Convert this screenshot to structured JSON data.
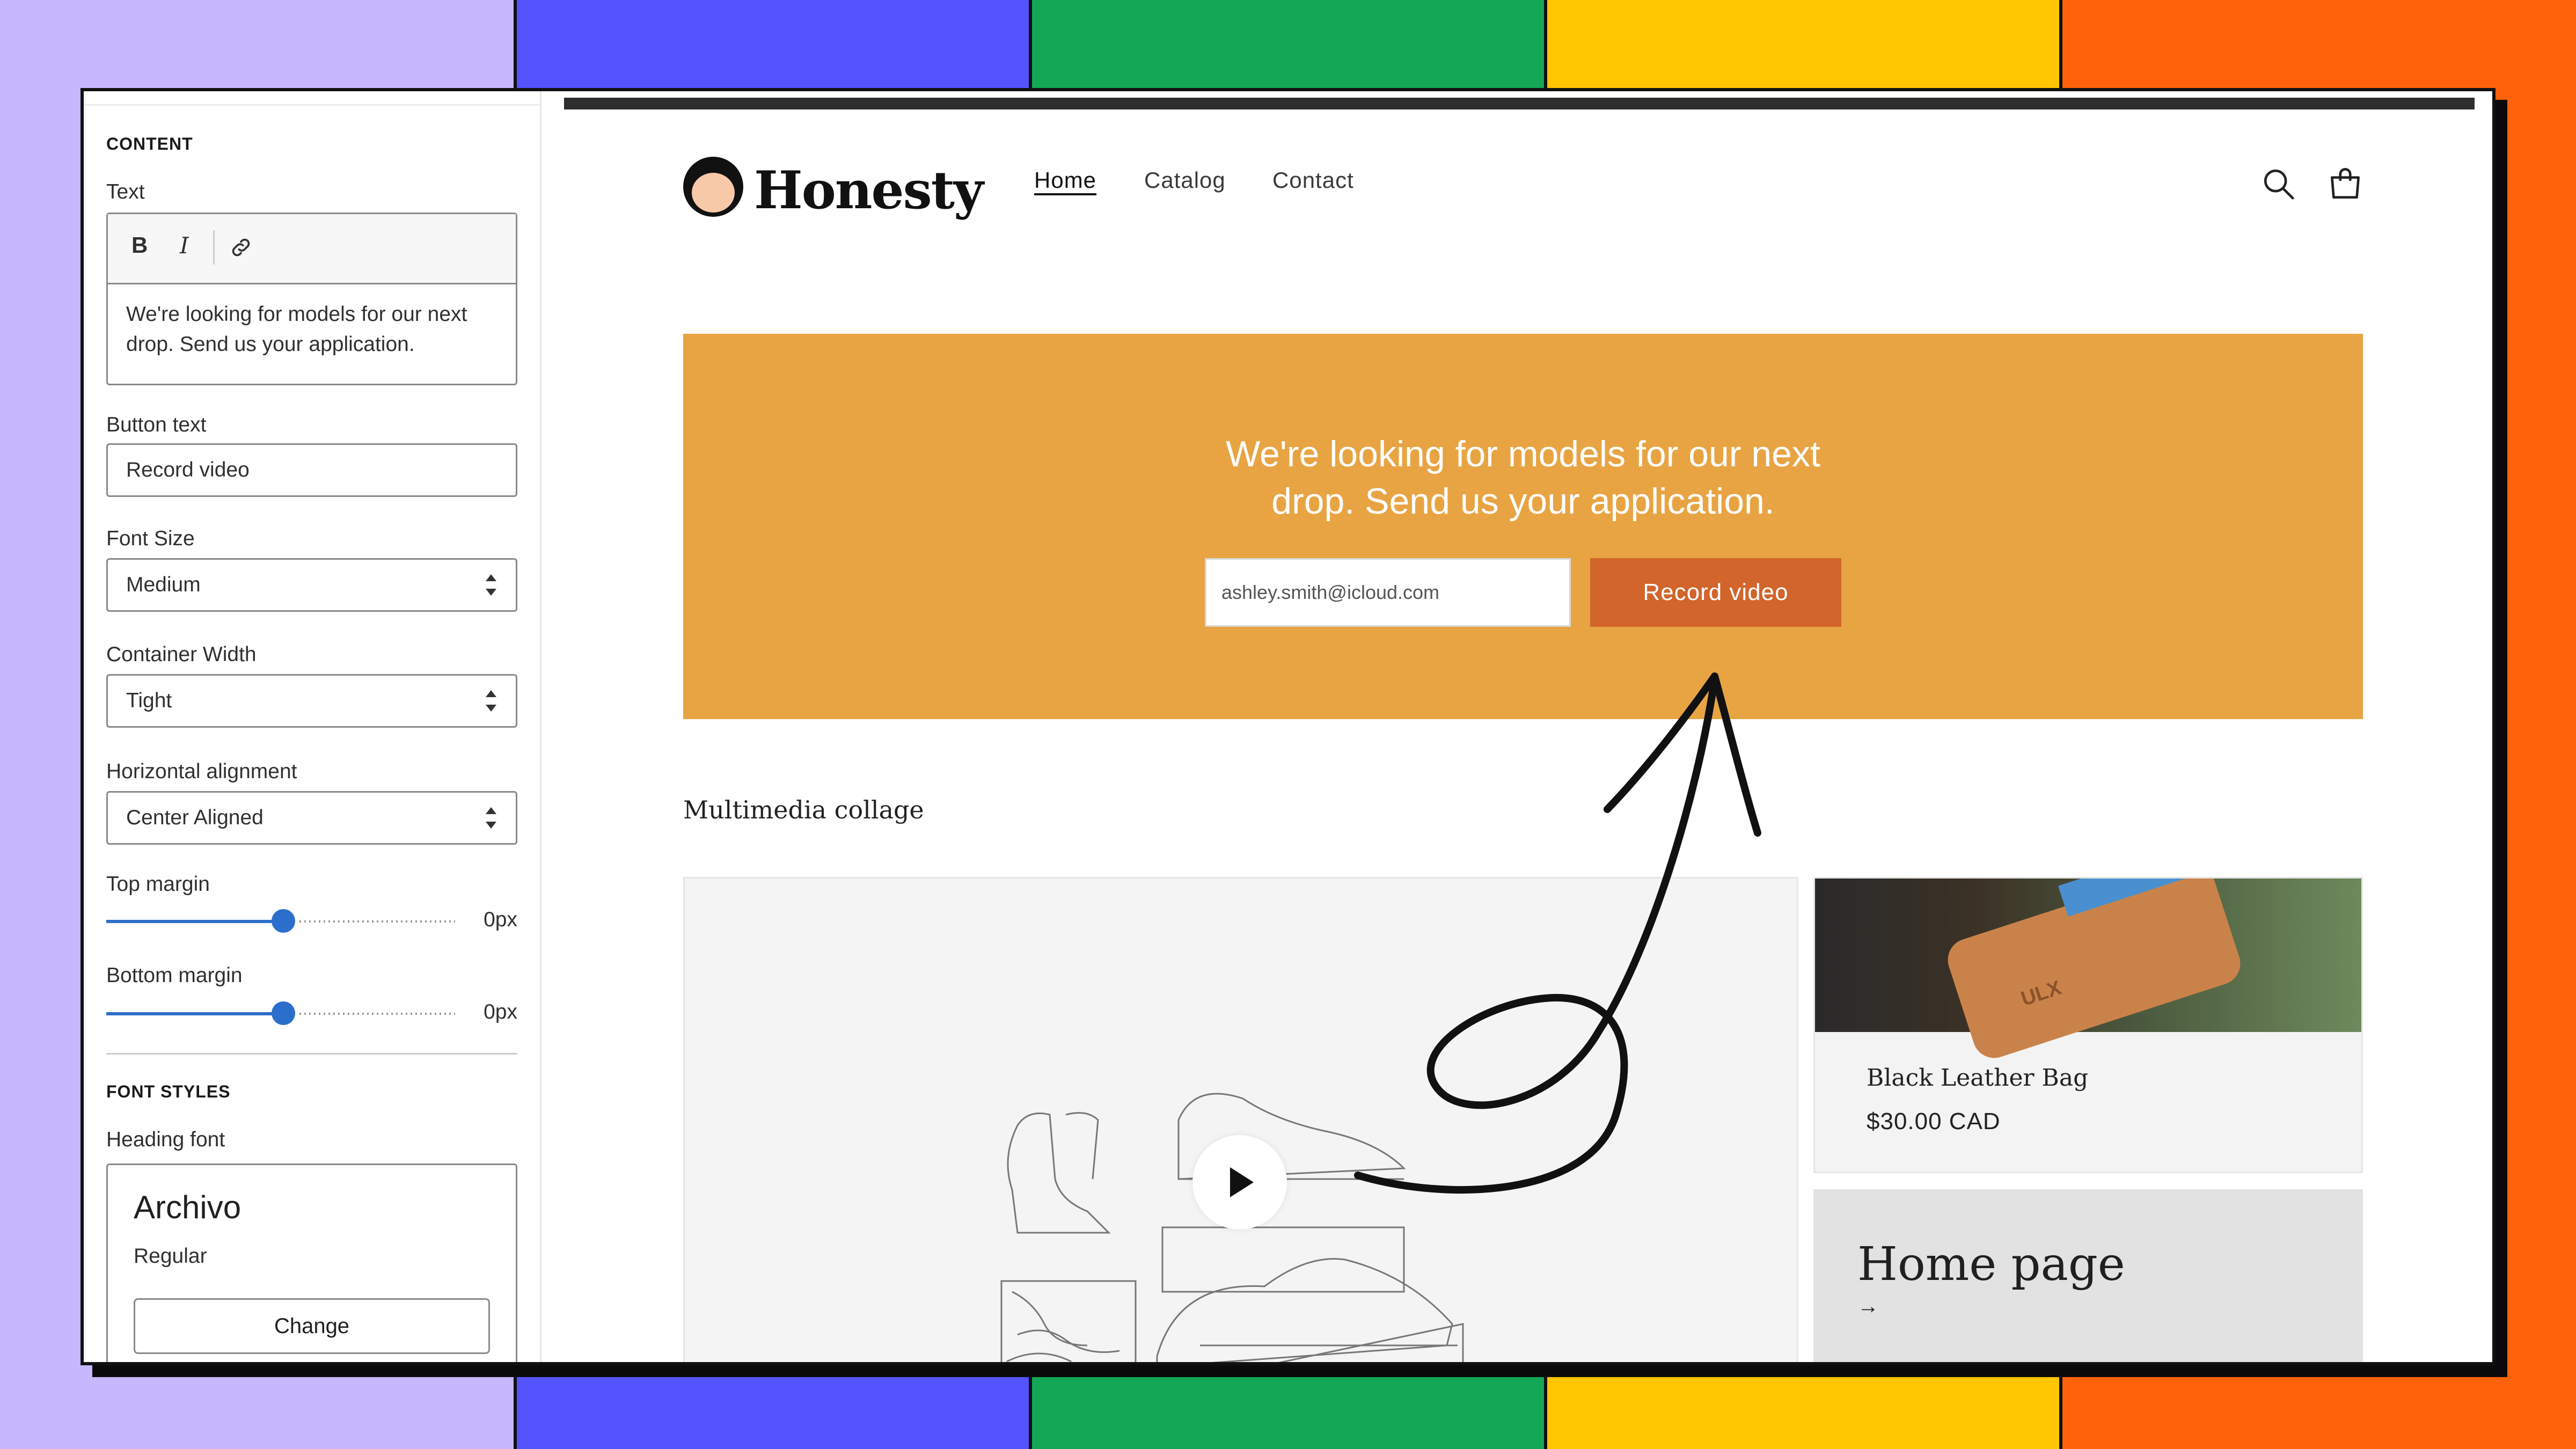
{
  "sidebar": {
    "content_title": "CONTENT",
    "text_label": "Text",
    "toolbar": {
      "bold": "B",
      "italic": "I"
    },
    "text_value": "We're looking for models for our next drop. Send us your application.",
    "button_text_label": "Button text",
    "button_text_value": "Record video",
    "font_size_label": "Font Size",
    "font_size_value": "Medium",
    "container_width_label": "Container Width",
    "container_width_value": "Tight",
    "horizontal_alignment_label": "Horizontal alignment",
    "horizontal_alignment_value": "Center Aligned",
    "top_margin_label": "Top margin",
    "top_margin_value": "0px",
    "bottom_margin_label": "Bottom margin",
    "bottom_margin_value": "0px",
    "font_styles_title": "FONT STYLES",
    "heading_font_label": "Heading font",
    "heading_font_name": "Archivo",
    "heading_font_style": "Regular",
    "change_button": "Change"
  },
  "store": {
    "logo_text": "Honesty",
    "nav": [
      "Home",
      "Catalog",
      "Contact"
    ],
    "banner_text_line1": "We're looking for models for our next",
    "banner_text_line2": "drop. Send us your application.",
    "email_value": "ashley.smith@icloud.com",
    "record_button": "Record video",
    "collage_title": "Multimedia collage",
    "product_name": "Black Leather Bag",
    "product_price": "$30.00 CAD",
    "wallet_brand": "ULX",
    "home_card_title": "Home page",
    "home_card_arrow": "→"
  },
  "colors": {
    "banner": "#e8a443",
    "button": "#d2652b",
    "slider": "#2c6ecb"
  },
  "icons": [
    "bold-icon",
    "italic-icon",
    "link-icon",
    "search-icon",
    "cart-icon",
    "play-icon",
    "select-arrows-icon"
  ]
}
